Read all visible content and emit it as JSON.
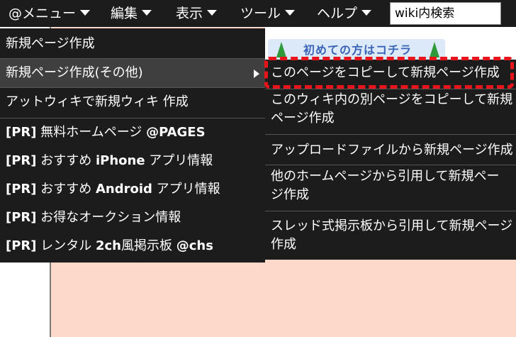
{
  "menubar": {
    "items": [
      {
        "label": "@メニュー"
      },
      {
        "label": "編集"
      },
      {
        "label": "表示"
      },
      {
        "label": "ツール"
      },
      {
        "label": "ヘルプ"
      }
    ],
    "search": {
      "value": "wiki内検索"
    },
    "background_color": "#1c1c1c"
  },
  "banner": {
    "text": "初めての方はコチラ"
  },
  "dropdown": {
    "items": [
      {
        "label": "新規ページ作成"
      },
      {
        "label": "新規ページ作成(その他)"
      },
      {
        "label": "アットウィキで新規ウィキ 作成"
      },
      {
        "prefix": "[PR]",
        "label": " 無料ホームページ ",
        "suffix": "@PAGES"
      },
      {
        "prefix": "[PR]",
        "label": " おすすめ ",
        "bold": "iPhone",
        "suffix": " アプリ情報"
      },
      {
        "prefix": "[PR]",
        "label": " おすすめ ",
        "bold": "Android",
        "suffix": " アプリ情報"
      },
      {
        "prefix": "[PR]",
        "label": " お得なオークション情報"
      },
      {
        "prefix": "[PR]",
        "label": " レンタル ",
        "bold": "2ch",
        "suffix": "風掲示板 ",
        "suffix_bold": "@chs"
      }
    ]
  },
  "submenu": {
    "items": [
      {
        "lines": [
          "このページをコピーして新規ページ作成"
        ]
      },
      {
        "lines": [
          "このウィキ内の別ページをコピーして新規",
          "ページ作成"
        ]
      },
      {
        "lines": [
          "アップロードファイルから新規ページ作成"
        ]
      },
      {
        "lines": [
          "他のホームページから引用して新規ペー",
          "ジ作成"
        ]
      },
      {
        "lines": [
          "スレッド式掲示板から引用して新規ページ",
          "作成"
        ]
      }
    ]
  },
  "colors": {
    "highlight": "#e8141b",
    "page_background": "#fdd9c9",
    "menu_background": "#1c1c1c",
    "active_item": "#3f3f3f"
  }
}
